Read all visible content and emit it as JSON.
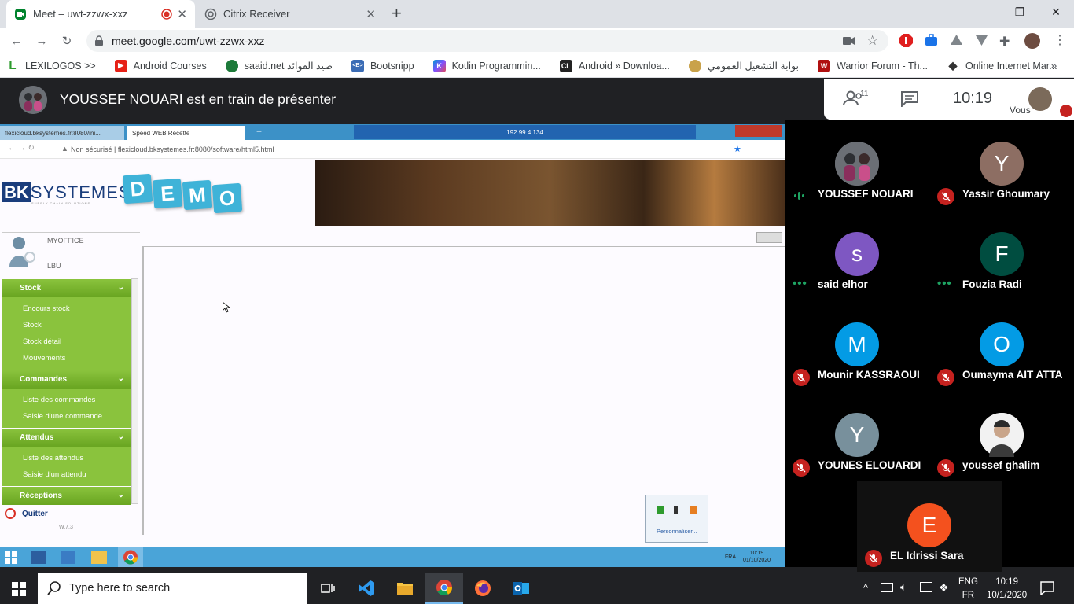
{
  "browser": {
    "tabs": [
      {
        "title": "Meet – uwt-zzwx-xxz",
        "active": true
      },
      {
        "title": "Citrix Receiver",
        "active": false
      }
    ],
    "new_tab": "+",
    "window_controls": {
      "minimize": "—",
      "maximize": "❐",
      "close": "✕"
    },
    "url": "meet.google.com/uwt-zzwx-xxz",
    "bookmarks": [
      {
        "label": "LEXILOGOS >>",
        "icon": "L",
        "color": "#2e9b2e"
      },
      {
        "label": "Android Courses",
        "icon": "▶",
        "color": "#e62117"
      },
      {
        "label": "saaid.net صيد الفوائد",
        "icon": "●",
        "color": "#1d7a3a"
      },
      {
        "label": "Bootsnipp",
        "icon": "<B>",
        "color": "#3b6cb5"
      },
      {
        "label": "Kotlin Programmin...",
        "icon": "K",
        "color": "#7f52ff"
      },
      {
        "label": "Android » Downloa...",
        "icon": "CL",
        "color": "#222222"
      },
      {
        "label": "بوابة التشغيل العمومي",
        "icon": "✺",
        "color": "#8a6a2a"
      },
      {
        "label": "Warrior Forum - Th...",
        "icon": "W",
        "color": "#b01010"
      },
      {
        "label": "Online Internet Mar...",
        "icon": "◆",
        "color": "#333333"
      }
    ],
    "more_bookmarks": "»"
  },
  "meet": {
    "presenter_banner": "YOUSSEF NOUARI est en train de présenter",
    "participants_count": "11",
    "clock": "10:19",
    "self_label": "Vous",
    "participants": [
      {
        "name": "YOUSSEF NOUARI",
        "initial": "",
        "color": "#5f6368",
        "status": "speaking"
      },
      {
        "name": "Yassir Ghoumary",
        "initial": "Y",
        "color": "#8d6e63",
        "status": "muted"
      },
      {
        "name": "said elhor",
        "initial": "s",
        "color": "#7e57c2",
        "status": "dots"
      },
      {
        "name": "Fouzia Radi",
        "initial": "F",
        "color": "#004d40",
        "status": "dots"
      },
      {
        "name": "Mounir KASSRAOUI",
        "initial": "M",
        "color": "#039be5",
        "status": "muted"
      },
      {
        "name": "Oumayma AIT ATTA",
        "initial": "O",
        "color": "#039be5",
        "status": "muted"
      },
      {
        "name": "YOUNES ELOUARDI",
        "initial": "Y",
        "color": "#78909c",
        "status": "muted"
      },
      {
        "name": "youssef ghalim",
        "initial": "",
        "color": "#e0e0e0",
        "status": "muted"
      },
      {
        "name": "EL Idrissi Sara",
        "initial": "E",
        "color": "#f4511e",
        "status": "muted"
      }
    ]
  },
  "shared": {
    "tab1": "flexicloud.bksystemes.fr:8080/ini...",
    "tab2": "Speed WEB Recette",
    "remote_ip": "192.99.4.134",
    "not_secure": "Non sécurisé",
    "remote_url": "flexicloud.bksystemes.fr:8080/software/html5.html",
    "logo_bk": "BK",
    "logo_systemes": "SYSTEMES",
    "logo_tagline": "SUPPLY CHAIN SOLUTIONS",
    "demo_letters": [
      "D",
      "E",
      "M",
      "O"
    ],
    "user_name": "MYOFFICE",
    "user_site": "LBU",
    "menu": [
      {
        "title": "Stock",
        "items": [
          "Encours stock",
          "Stock",
          "Stock détail",
          "Mouvements"
        ]
      },
      {
        "title": "Commandes",
        "items": [
          "Liste des commandes",
          "Saisie d'une commande"
        ]
      },
      {
        "title": "Attendus",
        "items": [
          "Liste des attendus",
          "Saisie d'un attendu"
        ]
      },
      {
        "title": "Réceptions",
        "items": []
      }
    ],
    "quit": "Quitter",
    "version": "W.7.3",
    "tray_customize": "Personnaliser...",
    "remote_lang": "FRA",
    "remote_time": "10:19",
    "remote_date": "01/10/2020"
  },
  "taskbar": {
    "search_placeholder": "Type here to search",
    "lang_top": "ENG",
    "lang_bottom": "FR",
    "time": "10:19",
    "date": "10/1/2020"
  }
}
